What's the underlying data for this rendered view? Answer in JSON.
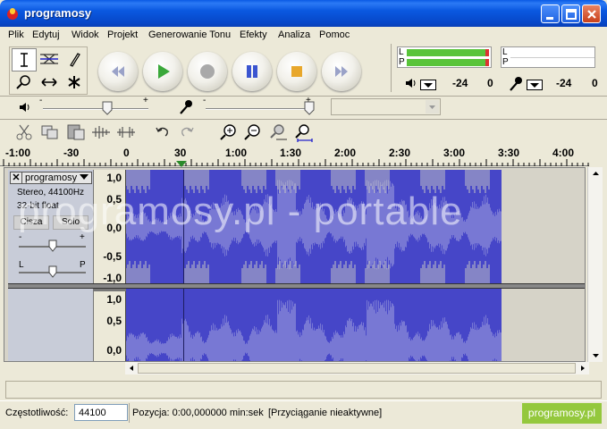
{
  "window": {
    "title": "programosy"
  },
  "menu": [
    "Plik",
    "Edytuj",
    "Widok",
    "Projekt",
    "Generowanie Tonu",
    "Efekty",
    "Analiza",
    "Pomoc"
  ],
  "meters": {
    "play_L": "L",
    "play_R": "P",
    "rec_L": "L",
    "rec_R": "P",
    "play_scale": [
      "-24",
      "0"
    ],
    "rec_scale": [
      "-24",
      "0"
    ]
  },
  "mixer": {
    "slider_min": "-",
    "slider_max": "+"
  },
  "timeline": {
    "ticks": [
      {
        "label": "-1:00"
      },
      {
        "label": "-30"
      },
      {
        "label": "0"
      },
      {
        "label": "30"
      },
      {
        "label": "1:00"
      },
      {
        "label": "1:30"
      },
      {
        "label": "2:00"
      },
      {
        "label": "2:30"
      },
      {
        "label": "3:00"
      },
      {
        "label": "3:30"
      },
      {
        "label": "4:00"
      }
    ]
  },
  "track": {
    "name": "programosy",
    "info_format": "Stereo, 44100Hz",
    "info_bits": "32-bit float",
    "mute_label": "Cisza",
    "solo_label": "Solo",
    "gain_min": "-",
    "gain_max": "+",
    "pan_left": "L",
    "pan_right": "P",
    "ch1_scale": [
      "1,0",
      "0,5",
      "0,0",
      "-0,5",
      "-1,0"
    ],
    "ch2_scale": [
      "1,0",
      "0,5",
      "0,0"
    ]
  },
  "watermark": "programosy.pl - portable",
  "status": {
    "rate_label": "Częstotliwość:",
    "rate_value": "44100",
    "position_text": "Pozycja: 0:00,000000 min:sek",
    "snap_text": "[Przyciąganie nieaktywne]",
    "brand": "programosy.pl"
  },
  "colors": {
    "wave_bg": "#4646c8",
    "wave_fg": "#8a8ad8",
    "titlebar": "#0a58e0",
    "brand": "#94c83d"
  }
}
